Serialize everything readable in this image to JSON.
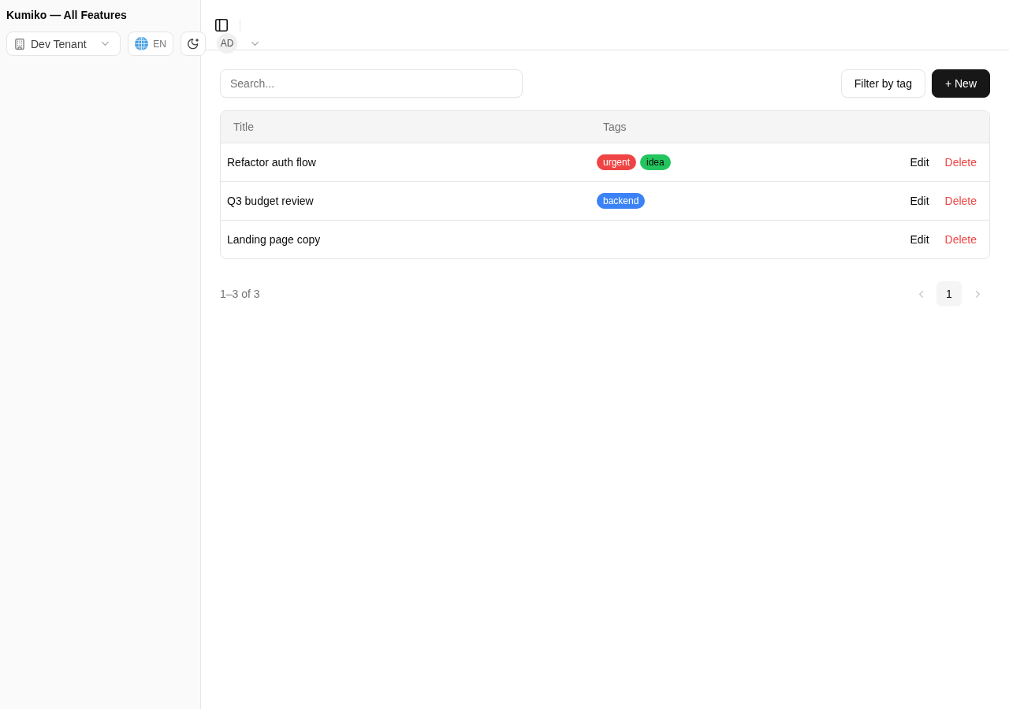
{
  "sidebar": {
    "title": "Kumiko — All Features",
    "tenant_select": {
      "value": "Dev Tenant"
    },
    "language_button": {
      "label": "EN"
    }
  },
  "header": {
    "user_menu": {
      "initials": "AD"
    }
  },
  "toolbar": {
    "search": {
      "placeholder": "Search..."
    },
    "buttons": [
      {
        "label": "Filter by tag",
        "kind": "outline"
      },
      {
        "label": "+ New",
        "kind": "primary"
      }
    ]
  },
  "table": {
    "columns": [
      "Title",
      "Tags"
    ],
    "rows": [
      {
        "title": "Refactor auth flow",
        "tags": [
          {
            "label": "urgent",
            "color": "#ef4444"
          },
          {
            "label": "idea",
            "color": "#22c55e"
          }
        ],
        "actions": [
          {
            "label": "Edit",
            "kind": "default"
          },
          {
            "label": "Delete",
            "kind": "danger"
          }
        ]
      },
      {
        "title": "Q3 budget review",
        "tags": [
          {
            "label": "backend",
            "color": "#3b82f6"
          }
        ],
        "actions": [
          {
            "label": "Edit",
            "kind": "default"
          },
          {
            "label": "Delete",
            "kind": "danger"
          }
        ]
      },
      {
        "title": "Landing page copy",
        "tags": [],
        "actions": [
          {
            "label": "Edit",
            "kind": "default"
          },
          {
            "label": "Delete",
            "kind": "danger"
          }
        ]
      }
    ]
  },
  "pagination": {
    "summary": "1–3 of 3",
    "previous": {
      "disabled": true
    },
    "pages": [
      {
        "label": "1",
        "selected": true
      }
    ],
    "next": {
      "disabled": true
    }
  }
}
